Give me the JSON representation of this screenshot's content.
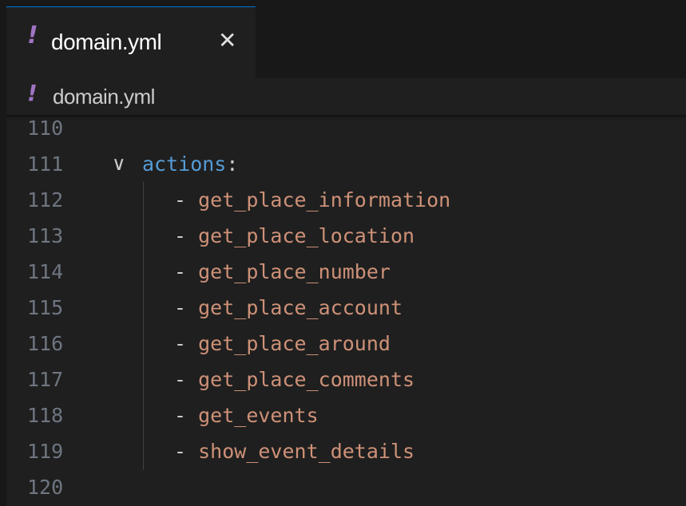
{
  "tab": {
    "icon": "yaml-exclamation-icon",
    "icon_glyph": "!",
    "label": "domain.yml",
    "close_glyph": "✕"
  },
  "breadcrumb": {
    "icon_glyph": "!",
    "label": "domain.yml"
  },
  "editor": {
    "lines": [
      {
        "number": "110"
      },
      {
        "number": "111",
        "fold": "∨",
        "key": "actions",
        "punct": ":"
      },
      {
        "number": "112",
        "dash": "-",
        "value": "get_place_information"
      },
      {
        "number": "113",
        "dash": "-",
        "value": "get_place_location"
      },
      {
        "number": "114",
        "dash": "-",
        "value": "get_place_number"
      },
      {
        "number": "115",
        "dash": "-",
        "value": "get_place_account"
      },
      {
        "number": "116",
        "dash": "-",
        "value": "get_place_around"
      },
      {
        "number": "117",
        "dash": "-",
        "value": "get_place_comments"
      },
      {
        "number": "118",
        "dash": "-",
        "value": "get_events"
      },
      {
        "number": "119",
        "dash": "-",
        "value": "show_event_details"
      },
      {
        "number": "120"
      }
    ]
  },
  "colors": {
    "background": "#1f1f1f",
    "line_number": "#6e7681",
    "key": "#569cd6",
    "string": "#ce9178",
    "yaml_icon": "#a074c4",
    "active_tab_border": "#0078d4"
  }
}
